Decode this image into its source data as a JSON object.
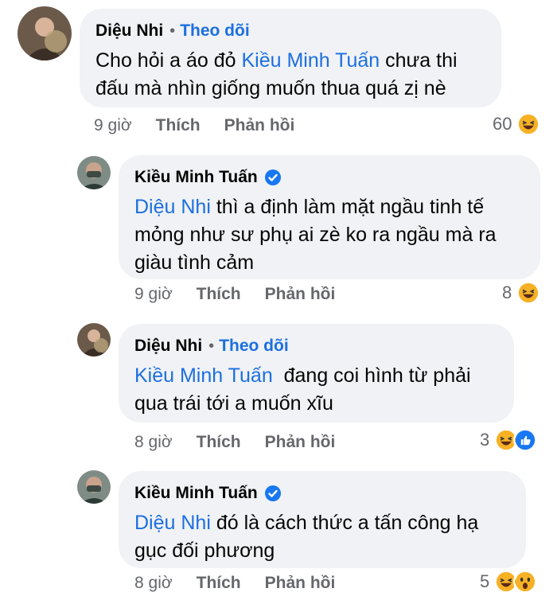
{
  "comments": [
    {
      "author": "Diệu Nhi",
      "follow_label": "Theo dõi",
      "text_lines": [
        {
          "mention": "",
          "pre": "Cho hỏi a áo đỏ ",
          "mention_mid": "Kiều Minh Tuấn",
          "post": " chưa thi"
        },
        {
          "mention": "",
          "pre": "đấu mà nhìn giống muốn thua quá zị nè",
          "mention_mid": "",
          "post": ""
        }
      ],
      "time": "9 giờ",
      "like_label": "Thích",
      "reply_label": "Phản hồi",
      "reaction_count": "60",
      "reactions": [
        "haha-icon"
      ]
    },
    {
      "author": "Kiều Minh Tuấn",
      "verified": true,
      "text_lines": [
        {
          "mention": "Diệu Nhi",
          "pre": " thì a định làm mặt ngầu tinh tế",
          "mention_mid": "",
          "post": ""
        },
        {
          "mention": "",
          "pre": "mỏng như sư phụ ai zè ko ra ngầu mà ra",
          "mention_mid": "",
          "post": ""
        },
        {
          "mention": "",
          "pre": "giàu tình cảm",
          "mention_mid": "",
          "post": ""
        }
      ],
      "time": "9 giờ",
      "like_label": "Thích",
      "reply_label": "Phản hồi",
      "reaction_count": "8",
      "reactions": [
        "haha-icon"
      ]
    },
    {
      "author": "Diệu Nhi",
      "follow_label": "Theo dõi",
      "text_lines": [
        {
          "mention": "Kiều Minh Tuấn",
          "pre": "  đang coi hình từ phải",
          "mention_mid": "",
          "post": ""
        },
        {
          "mention": "",
          "pre": "qua trái tới a muốn xĩu",
          "mention_mid": "",
          "post": ""
        }
      ],
      "time": "8 giờ",
      "like_label": "Thích",
      "reply_label": "Phản hồi",
      "reaction_count": "3",
      "reactions": [
        "haha-icon",
        "like-icon"
      ]
    },
    {
      "author": "Kiều Minh Tuấn",
      "verified": true,
      "text_lines": [
        {
          "mention": "Diệu Nhi",
          "pre": " đó là cách thức a tấn công hạ",
          "mention_mid": "",
          "post": ""
        },
        {
          "mention": "",
          "pre": "gục đối phương",
          "mention_mid": "",
          "post": ""
        }
      ],
      "time": "8 giờ",
      "like_label": "Thích",
      "reply_label": "Phản hồi",
      "reaction_count": "5",
      "reactions": [
        "haha-icon",
        "wow-icon"
      ]
    }
  ],
  "colors": {
    "bubble": "#f0f2f5",
    "mention": "#1c6fe0",
    "muted": "#65676b",
    "verified": "#1877f2",
    "haha": "#f7b125"
  }
}
